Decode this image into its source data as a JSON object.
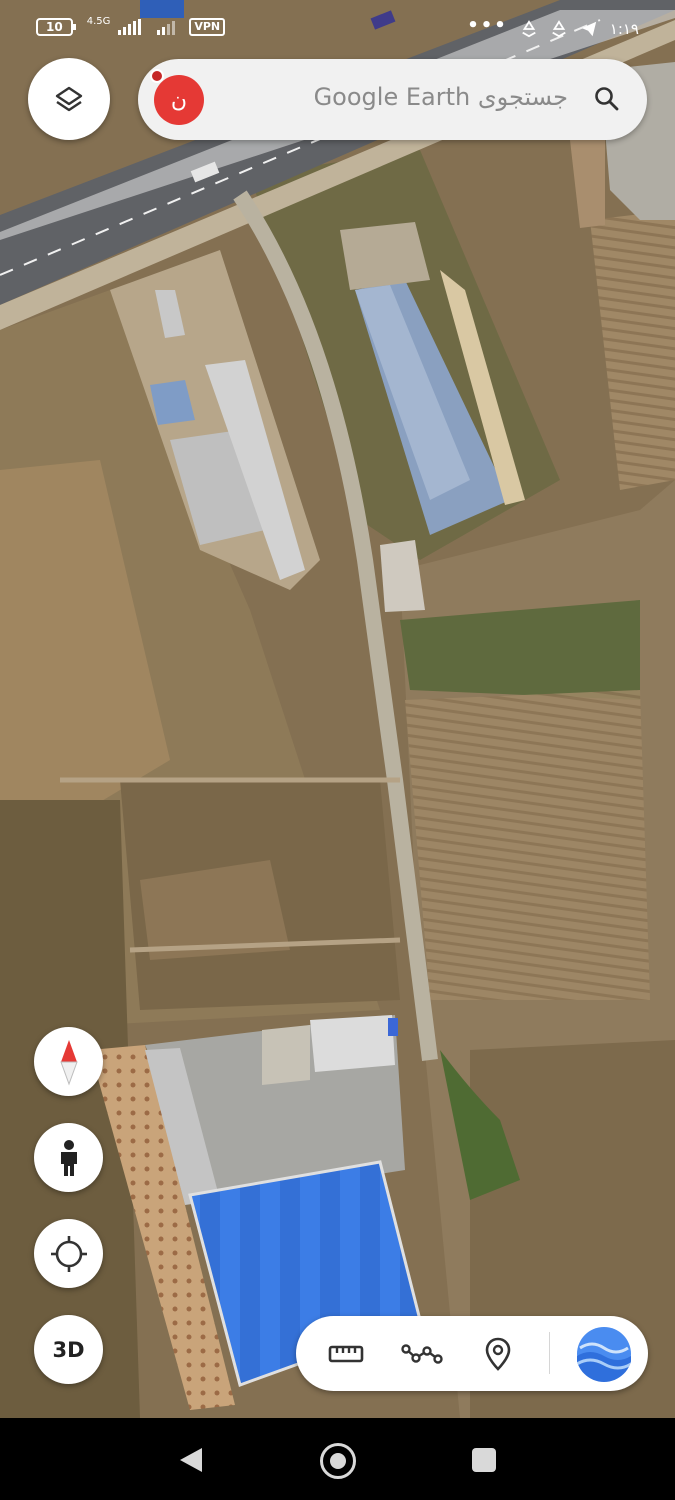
{
  "status_bar": {
    "battery": "10",
    "network": "4.5G",
    "vpn": "VPN",
    "overflow_dots": "•••",
    "time": "۱:۱۹"
  },
  "search": {
    "avatar_initial": "ن",
    "placeholder": "جستجوی Google Earth"
  },
  "map_controls": {
    "three_d_label": "3D"
  },
  "icons": {
    "layers": "layers-icon",
    "search": "search-icon",
    "compass": "compass-icon",
    "pegman": "person-icon",
    "my_location": "crosshair-icon",
    "ruler": "ruler-icon",
    "path": "path-icon",
    "pin": "pin-icon",
    "earth": "earth-logo-icon"
  },
  "colors": {
    "avatar": "#e53935",
    "compass_north": "#e53935",
    "earth_logo": "#4285f4"
  }
}
